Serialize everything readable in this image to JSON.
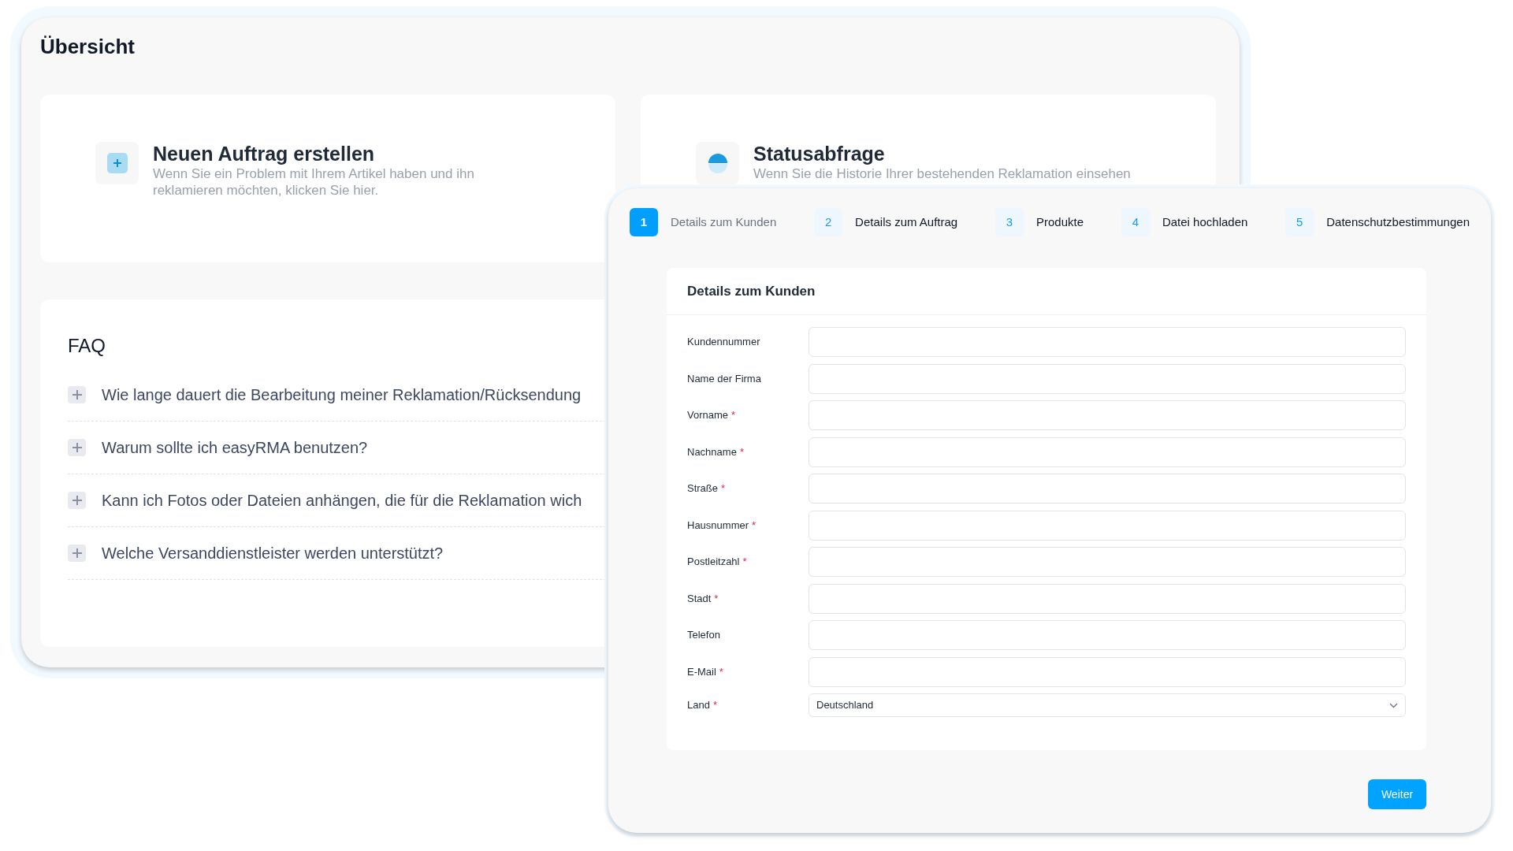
{
  "overview": {
    "title": "Übersicht",
    "cards": [
      {
        "kind": "create",
        "title": "Neuen Auftrag erstellen",
        "description": "Wenn Sie ein Problem mit Ihrem Artikel haben und ihn reklamieren möchten, klicken Sie hier."
      },
      {
        "kind": "status",
        "title": "Statusabfrage",
        "description": "Wenn Sie die Historie Ihrer bestehenden Reklamation einsehen"
      }
    ],
    "faq": {
      "title": "FAQ",
      "items": [
        {
          "question": "Wie lange dauert die Bearbeitung meiner Reklamation/Rücksendung",
          "expanded": false
        },
        {
          "question": "Warum sollte ich easyRMA benutzen?",
          "expanded": false
        },
        {
          "question": "Kann ich Fotos oder Dateien anhängen, die für die Reklamation wich",
          "expanded": false
        },
        {
          "question": "Welche Versanddienstleister werden unterstützt?",
          "expanded": false
        }
      ]
    }
  },
  "wizard": {
    "steps": [
      {
        "number": "1",
        "label": "Details zum Kunden",
        "selected": true
      },
      {
        "number": "2",
        "label": "Details zum Auftrag",
        "selected": false
      },
      {
        "number": "3",
        "label": "Produkte",
        "selected": false
      },
      {
        "number": "4",
        "label": "Datei hochladen",
        "selected": false
      },
      {
        "number": "5",
        "label": "Datenschutzbestimmungen",
        "selected": false
      }
    ],
    "form": {
      "title": "Details zum Kunden",
      "fields": [
        {
          "kind": "text",
          "label": "Kundennummer"
        },
        {
          "kind": "text",
          "label": "Name der Firma"
        },
        {
          "kind": "text",
          "label": "Vorname",
          "required_mark": "*"
        },
        {
          "kind": "text",
          "label": "Nachname",
          "required_mark": "*"
        },
        {
          "kind": "text",
          "label": "Straße",
          "required_mark": "*"
        },
        {
          "kind": "text",
          "label": "Hausnummer",
          "required_mark": "*"
        },
        {
          "kind": "text",
          "label": "Postleitzahl",
          "required_mark": "*"
        },
        {
          "kind": "text",
          "label": "Stadt",
          "required_mark": "*"
        },
        {
          "kind": "text",
          "label": "Telefon"
        },
        {
          "kind": "text",
          "label": "E-Mail",
          "required_mark": "*"
        },
        {
          "kind": "select",
          "label": "Land",
          "required_mark": "*",
          "value": "Deutschland"
        }
      ]
    },
    "button": "Weiter"
  }
}
